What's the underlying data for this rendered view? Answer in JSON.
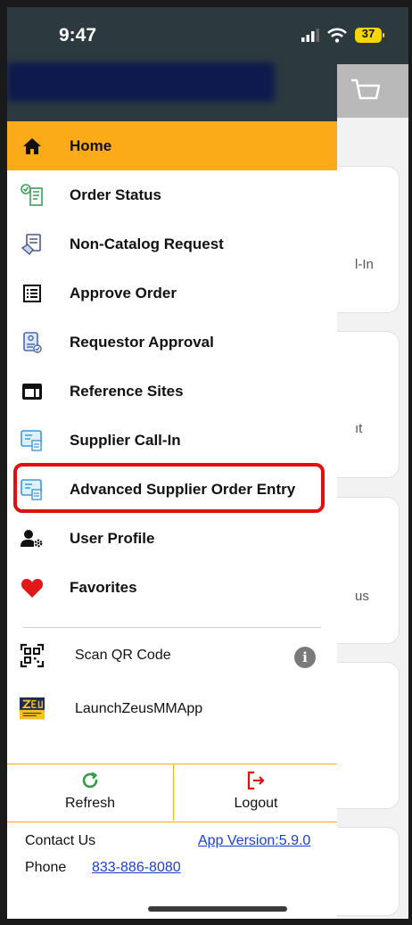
{
  "status_bar": {
    "time": "9:47",
    "battery": "37"
  },
  "background_cards": [
    {
      "text": "l-In"
    },
    {
      "text": "ıt"
    },
    {
      "text": "us"
    },
    {
      "text": ""
    }
  ],
  "menu": {
    "items": [
      {
        "label": "Home",
        "icon": "home-icon",
        "active": true
      },
      {
        "label": "Order Status",
        "icon": "order-status-icon"
      },
      {
        "label": "Non-Catalog Request",
        "icon": "non-catalog-icon"
      },
      {
        "label": "Approve Order",
        "icon": "approve-list-icon"
      },
      {
        "label": "Requestor Approval",
        "icon": "requestor-approval-icon"
      },
      {
        "label": "Reference Sites",
        "icon": "reference-sites-icon"
      },
      {
        "label": "Supplier Call-In",
        "icon": "supplier-call-in-icon"
      },
      {
        "label": "Advanced Supplier Order Entry",
        "icon": "advanced-supplier-icon"
      },
      {
        "label": "User Profile",
        "icon": "user-settings-icon"
      },
      {
        "label": "Favorites",
        "icon": "heart-icon"
      }
    ],
    "extras": [
      {
        "label": "Scan QR Code",
        "icon": "qr-code-icon"
      },
      {
        "label": "LaunchZeusMMApp",
        "icon": "zeus-logo-icon"
      }
    ]
  },
  "footer": {
    "refresh_label": "Refresh",
    "logout_label": "Logout",
    "contact_label": "Contact Us",
    "app_version": "App Version:5.9.0",
    "phone_label": "Phone",
    "phone_number": "833-886-8080"
  },
  "colors": {
    "accent": "#fbab18",
    "header": "#2c3a3f",
    "highlight": "#e01010",
    "link": "#1a3fd0",
    "refresh": "#2e9e3e",
    "logout": "#e01010"
  }
}
